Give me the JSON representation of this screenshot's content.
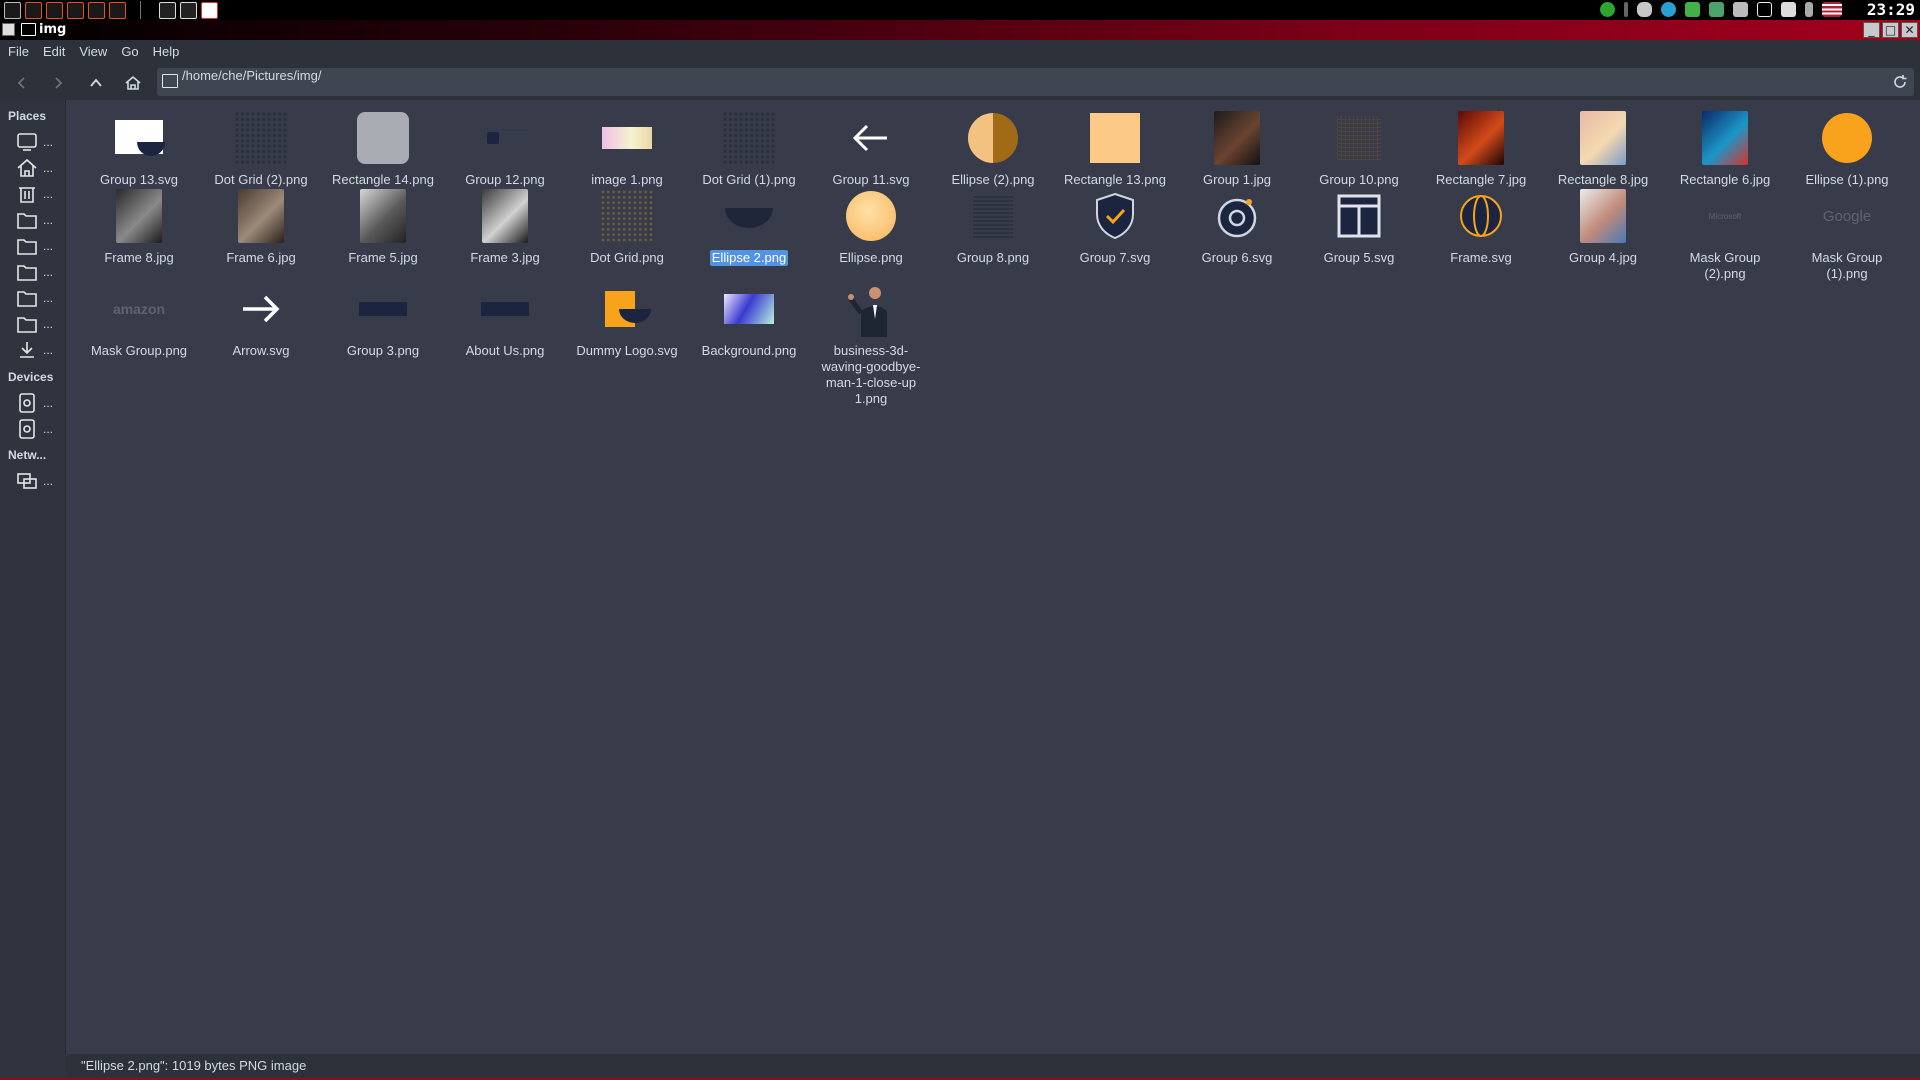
{
  "panel": {
    "clock": "23:29"
  },
  "window": {
    "title": "img",
    "controls": [
      "minimize",
      "maximize",
      "close"
    ]
  },
  "menu": [
    "File",
    "Edit",
    "View",
    "Go",
    "Help"
  ],
  "location": {
    "path": "/home/che/Pictures/img/"
  },
  "sidebar": {
    "places_header": "Places",
    "devices_header": "Devices",
    "network_header": "Netw...",
    "places_items": [
      "computer",
      "home",
      "trash",
      "folder",
      "folder",
      "folder",
      "folder",
      "folder",
      "download"
    ],
    "device_items": [
      "drive",
      "drive"
    ],
    "network_items": [
      "network"
    ],
    "item_label": "..."
  },
  "files": [
    {
      "name": "Group 13.svg",
      "kind": "g13"
    },
    {
      "name": "Dot Grid (2).png",
      "kind": "dotgrid"
    },
    {
      "name": "Rectangle 14.png",
      "kind": "rect14"
    },
    {
      "name": "Group 12.png",
      "kind": "g12"
    },
    {
      "name": "image 1.png",
      "kind": "image1"
    },
    {
      "name": "Dot Grid (1).png",
      "kind": "dotgrid"
    },
    {
      "name": "Group 11.svg",
      "kind": "arrowleft"
    },
    {
      "name": "Ellipse (2).png",
      "kind": "halfcircle"
    },
    {
      "name": "Rectangle 13.png",
      "kind": "rect13"
    },
    {
      "name": "Group 1.jpg",
      "kind": "photo-face"
    },
    {
      "name": "Group 10.png",
      "kind": "g10"
    },
    {
      "name": "Rectangle 7.jpg",
      "kind": "photo-fire"
    },
    {
      "name": "Rectangle 8.jpg",
      "kind": "photo-art"
    },
    {
      "name": "Rectangle 6.jpg",
      "kind": "photo-blue"
    },
    {
      "name": "Ellipse (1).png",
      "kind": "orangecircle"
    },
    {
      "name": "Frame 8.jpg",
      "kind": "photo-desk"
    },
    {
      "name": "Frame 6.jpg",
      "kind": "photo-people"
    },
    {
      "name": "Frame 5.jpg",
      "kind": "photo-laptop"
    },
    {
      "name": "Frame 3.jpg",
      "kind": "photo-sketch"
    },
    {
      "name": "Dot Grid.png",
      "kind": "dotgrid-brown"
    },
    {
      "name": "Ellipse 2.png",
      "kind": "ellipse2"
    },
    {
      "name": "Ellipse.png",
      "kind": "ellipse"
    },
    {
      "name": "Group 8.png",
      "kind": "g8"
    },
    {
      "name": "Group 7.svg",
      "kind": "shield"
    },
    {
      "name": "Group 6.svg",
      "kind": "target"
    },
    {
      "name": "Group 5.svg",
      "kind": "layout"
    },
    {
      "name": "Frame.svg",
      "kind": "frame"
    },
    {
      "name": "Group 4.jpg",
      "kind": "photo-person"
    },
    {
      "name": "Mask Group (2).png",
      "kind": "logo",
      "logo_text": "Microsoft"
    },
    {
      "name": "Mask Group (1).png",
      "kind": "logo",
      "logo_text": "Google"
    },
    {
      "name": "Mask Group.png",
      "kind": "logo",
      "logo_text": "amazon"
    },
    {
      "name": "Arrow.svg",
      "kind": "arrowright"
    },
    {
      "name": "Group 3.png",
      "kind": "bar"
    },
    {
      "name": "About Us.png",
      "kind": "bar"
    },
    {
      "name": "Dummy Logo.svg",
      "kind": "dummylogo"
    },
    {
      "name": "Background.png",
      "kind": "background"
    },
    {
      "name": "business-3d-waving-goodbye-man-1-close-up 1.png",
      "kind": "businessman"
    }
  ],
  "selected_file": "Ellipse 2.png",
  "status": "\"Ellipse 2.png\": 1019 bytes PNG image",
  "colors": {
    "bg": "#383c4a",
    "selection": "#5294e2",
    "accent_orange": "#f9a21b",
    "titlebar_red": "#a2001d"
  }
}
